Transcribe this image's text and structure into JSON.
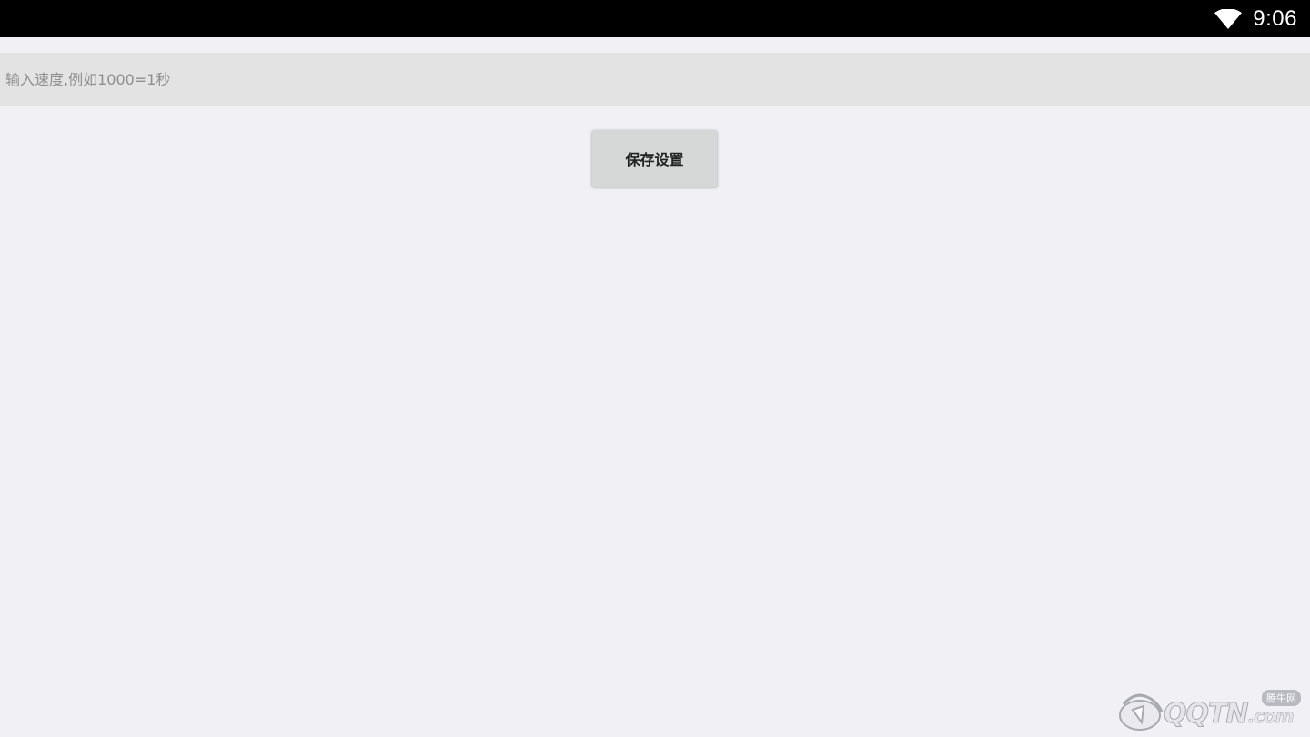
{
  "status_bar": {
    "time": "9:06",
    "wifi_icon": "wifi-icon"
  },
  "speed_input": {
    "placeholder": "输入速度,例如1000=1秒",
    "value": ""
  },
  "save_button": {
    "label": "保存设置"
  },
  "watermark": {
    "site": "QQTN",
    "domain_suffix": ".com",
    "cn_name": "腾牛网"
  }
}
